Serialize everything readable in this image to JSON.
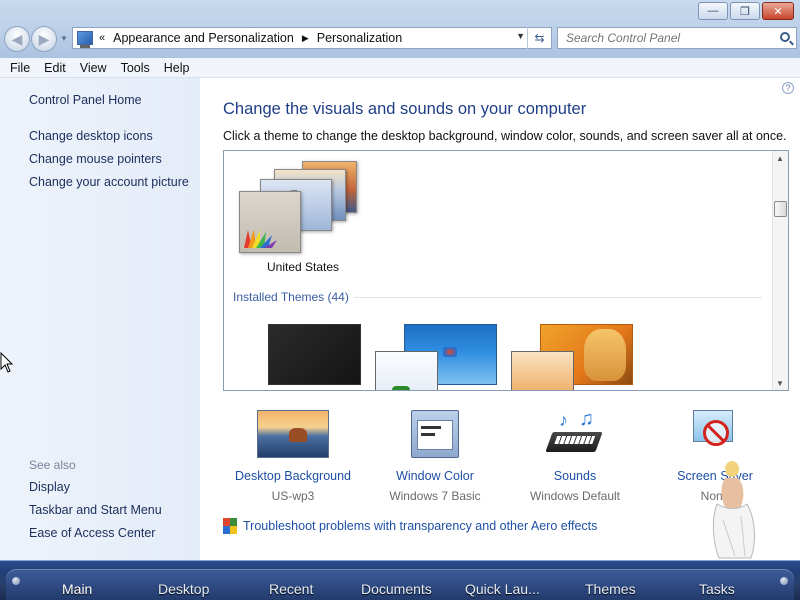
{
  "window": {
    "controls": {
      "minimize": "—",
      "maximize": "❐",
      "close": "✕"
    }
  },
  "address": {
    "overflow_glyph": "«",
    "crumbs": [
      "Appearance and Personalization",
      "Personalization"
    ],
    "separator_glyph": "▶"
  },
  "search": {
    "placeholder": "Search Control Panel"
  },
  "menu": [
    "File",
    "Edit",
    "View",
    "Tools",
    "Help"
  ],
  "sidebar": {
    "home": "Control Panel Home",
    "tasks": [
      "Change desktop icons",
      "Change mouse pointers",
      "Change your account picture"
    ],
    "see_also_heading": "See also",
    "see_also": [
      "Display",
      "Taskbar and Start Menu",
      "Ease of Access Center"
    ]
  },
  "main": {
    "help_glyph": "?",
    "title": "Change the visuals and sounds on your computer",
    "subtitle": "Click a theme to change the desktop background, window color, sounds, and screen saver all at once.",
    "my_theme_name": "United States",
    "installed_heading": "Installed Themes (44)"
  },
  "settings": [
    {
      "label": "Desktop Background",
      "value": "US-wp3",
      "icon": "desktop-background-icon"
    },
    {
      "label": "Window Color",
      "value": "Windows 7 Basic",
      "icon": "window-color-icon"
    },
    {
      "label": "Sounds",
      "value": "Windows Default",
      "icon": "sounds-icon"
    },
    {
      "label": "Screen Saver",
      "value": "None",
      "icon": "screen-saver-icon"
    }
  ],
  "troubleshoot": "Troubleshoot problems with transparency and other Aero effects",
  "dock": [
    "Main",
    "Desktop",
    "Recent",
    "Documents",
    "Quick Lau...",
    "Themes",
    "Tasks"
  ],
  "colors": {
    "link": "#1e4fa5",
    "title": "#1e3e85",
    "dock": "#213f78"
  }
}
